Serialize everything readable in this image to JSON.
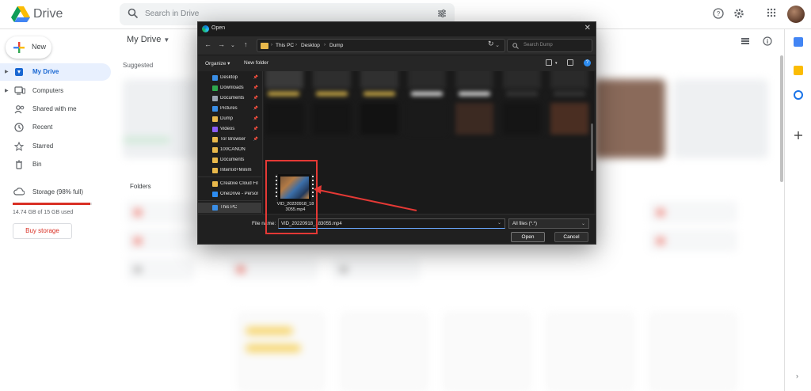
{
  "app": {
    "name": "Drive"
  },
  "search": {
    "placeholder": "Search in Drive"
  },
  "sidebar": {
    "new_label": "New",
    "items": [
      {
        "label": "My Drive",
        "icon": "my-drive-icon",
        "active": true
      },
      {
        "label": "Computers",
        "icon": "computers-icon"
      },
      {
        "label": "Shared with me",
        "icon": "shared-icon"
      },
      {
        "label": "Recent",
        "icon": "clock-icon"
      },
      {
        "label": "Starred",
        "icon": "star-icon"
      },
      {
        "label": "Bin",
        "icon": "bin-icon"
      }
    ],
    "storage": {
      "label": "Storage (98% full)",
      "used_text": "14.74 GB of 15 GB used",
      "fraction": 0.98,
      "buy_label": "Buy storage"
    }
  },
  "main": {
    "title": "My Drive",
    "suggested_label": "Suggested",
    "folders_label": "Folders"
  },
  "dialog": {
    "title": "Open",
    "breadcrumb": [
      "This PC",
      "Desktop",
      "Dump"
    ],
    "search_placeholder": "Search Dump",
    "organize_label": "Organize",
    "new_folder_label": "New folder",
    "nav_items": [
      {
        "label": "Desktop",
        "color": "#3a8ee6",
        "pinned": true
      },
      {
        "label": "Downloads",
        "color": "#2fa84f",
        "pinned": true
      },
      {
        "label": "Documents",
        "color": "#9aa4b1",
        "pinned": true
      },
      {
        "label": "Pictures",
        "color": "#3a8ee6",
        "pinned": true
      },
      {
        "label": "Dump",
        "color": "#e8b84b",
        "pinned": true
      },
      {
        "label": "Videos",
        "color": "#8a5cf6",
        "pinned": true
      },
      {
        "label": "Tor Browser",
        "color": "#e8b84b",
        "pinned": true
      },
      {
        "label": "100CANON",
        "color": "#e8b84b",
        "pinned": false
      },
      {
        "label": "Documents",
        "color": "#e8b84b",
        "pinned": false
      },
      {
        "label": "Internxt+Minim",
        "color": "#e8b84b",
        "pinned": false
      },
      {
        "label": "Creative Cloud Fil",
        "color": "#e8b84b",
        "pinned": false
      },
      {
        "label": "OneDrive - Persor",
        "color": "#2d8cf0",
        "pinned": false
      },
      {
        "label": "This PC",
        "color": "#3a8ee6",
        "pinned": false,
        "selected": true
      }
    ],
    "selected_file": {
      "name_line1": "VID_20220918_18",
      "name_line2": "3055.mp4"
    },
    "file_name_label": "File name:",
    "file_name_value": "VID_20220918_183055.mp4",
    "file_type_value": "All files (*.*)",
    "open_label": "Open",
    "cancel_label": "Cancel"
  },
  "colors": {
    "accent": "#1a73e8",
    "warning": "#d93025",
    "highlight": "#e53935"
  }
}
